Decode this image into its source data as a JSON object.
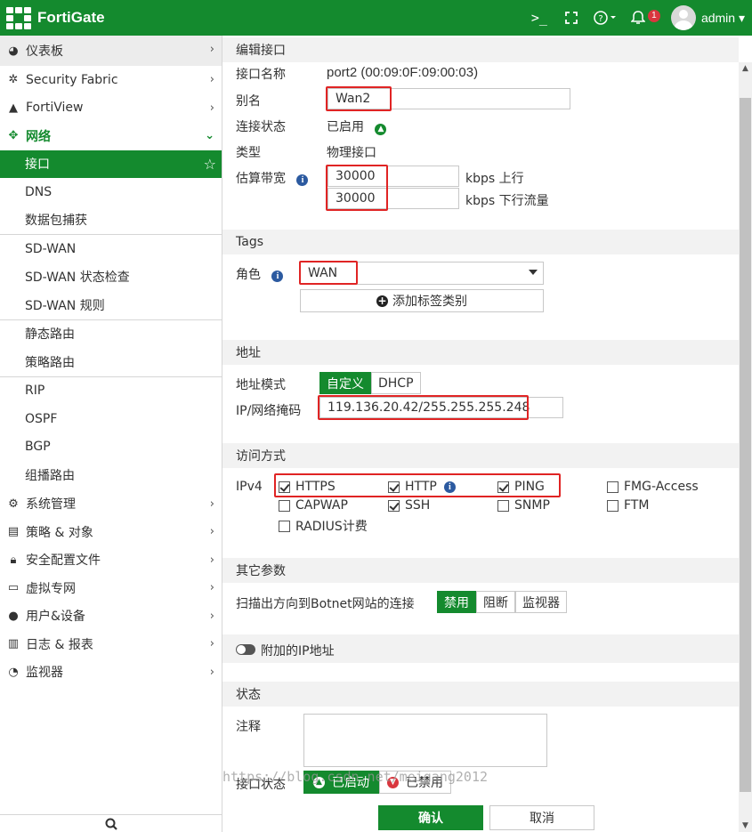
{
  "header": {
    "brand": "FortiGate",
    "cli_icon": ">_",
    "notification_count": "1",
    "user": "admin"
  },
  "sidebar": {
    "items": [
      {
        "label": "仪表板",
        "icon": "dashboard-icon"
      },
      {
        "label": "Security Fabric",
        "icon": "fabric-icon"
      },
      {
        "label": "FortiView",
        "icon": "fortiview-icon"
      },
      {
        "label": "网络",
        "icon": "network-icon"
      }
    ],
    "network_sub": [
      "接口",
      "DNS",
      "数据包捕获",
      "SD-WAN",
      "SD-WAN 状态检查",
      "SD-WAN 规则",
      "静态路由",
      "策略路由",
      "RIP",
      "OSPF",
      "BGP",
      "组播路由"
    ],
    "bottom_items": [
      "系统管理",
      "策略 & 对象",
      "安全配置文件",
      "虚拟专网",
      "用户&设备",
      "日志 & 报表",
      "监视器"
    ]
  },
  "edit": {
    "title": "编辑接口",
    "name_label": "接口名称",
    "name_value": "port2 (00:09:0F:09:00:03)",
    "alias_label": "别名",
    "alias_value": "Wan2",
    "status_label": "连接状态",
    "status_value": "已启用",
    "type_label": "类型",
    "type_value": "物理接口",
    "bw_label": "估算带宽",
    "bw_up": "30000",
    "bw_up_unit": "kbps 上行",
    "bw_down": "30000",
    "bw_down_unit": "kbps 下行流量"
  },
  "tags": {
    "title": "Tags",
    "role_label": "角色",
    "role_value": "WAN",
    "add_label": "添加标签类别"
  },
  "address": {
    "title": "地址",
    "mode_label": "地址模式",
    "mode_custom": "自定义",
    "mode_dhcp": "DHCP",
    "ip_label": "IP/网络掩码",
    "ip_value": "119.136.20.42/255.255.255.248"
  },
  "access": {
    "title": "访问方式",
    "ipv4_label": "IPv4",
    "options": {
      "https": "HTTPS",
      "http": "HTTP",
      "ping": "PING",
      "fmg": "FMG-Access",
      "capwap": "CAPWAP",
      "ssh": "SSH",
      "snmp": "SNMP",
      "ftm": "FTM",
      "radius": "RADIUS计费"
    }
  },
  "misc": {
    "title": "其它参数",
    "botnet_label": "扫描出方向到Botnet网站的连接",
    "opt_disable": "禁用",
    "opt_block": "阻断",
    "opt_monitor": "监视器",
    "extra_ip_label": "附加的IP地址"
  },
  "state": {
    "title": "状态",
    "comment_label": "注释",
    "iface_state_label": "接口状态",
    "enabled": "已启动",
    "disabled": "已禁用"
  },
  "footer": {
    "ok": "确认",
    "cancel": "取消",
    "watermark": "https://blog.csdn.net/meigang2012"
  },
  "colors": {
    "brand_green": "#148a2e",
    "highlight_red": "#e02424"
  }
}
